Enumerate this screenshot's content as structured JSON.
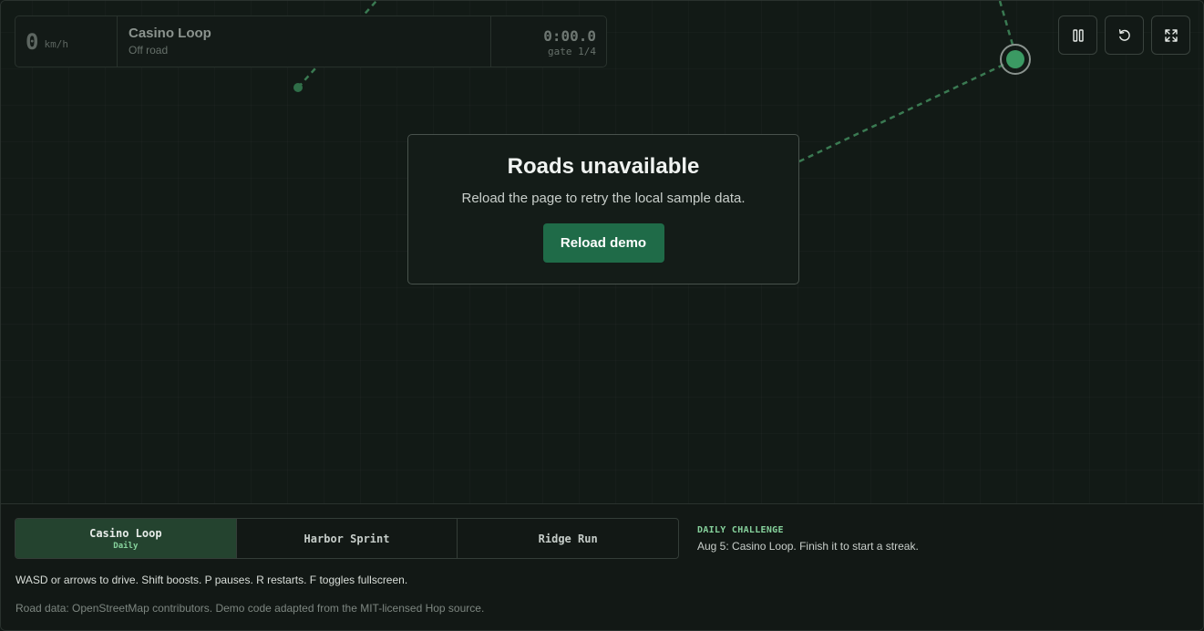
{
  "hud": {
    "speed": "0",
    "speed_unit": "km/h",
    "track_name": "Casino Loop",
    "track_status": "Off road",
    "time": "0:00.0",
    "gate": "gate 1/4"
  },
  "controls": {
    "pause_icon": "pause-icon",
    "restart_icon": "restart-icon",
    "fullscreen_icon": "fullscreen-icon"
  },
  "modal": {
    "title": "Roads unavailable",
    "message": "Reload the page to retry the local sample data.",
    "button": "Reload demo"
  },
  "tracks": [
    {
      "label": "Casino Loop",
      "badge": "Daily",
      "active": true
    },
    {
      "label": "Harbor Sprint",
      "badge": "",
      "active": false
    },
    {
      "label": "Ridge Run",
      "badge": "",
      "active": false
    }
  ],
  "daily": {
    "tag": "DAILY CHALLENGE",
    "text": "Aug 5: Casino Loop. Finish it to start a streak."
  },
  "help_text": "WASD or arrows to drive. Shift boosts. P pauses. R restarts. F toggles fullscreen.",
  "credits": "Road data: OpenStreetMap contributors. Demo code adapted from the MIT-licensed Hop source.",
  "colors": {
    "accent": "#1f6b48",
    "accent_light": "#86d29c",
    "background": "#111714"
  }
}
